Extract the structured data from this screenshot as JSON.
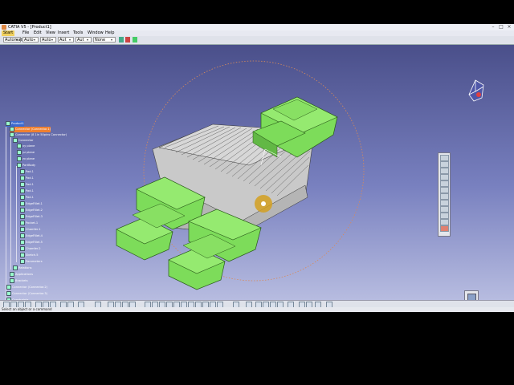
{
  "window": {
    "title": "CATIA V5 - [Product1]"
  },
  "menu": [
    "Start",
    "File",
    "Edit",
    "View",
    "Insert",
    "Tools",
    "Window",
    "Help"
  ],
  "toolbar": {
    "combos": [
      "Automatic",
      "Auto",
      "Auto",
      "Aut",
      "Aut",
      "None"
    ]
  },
  "tree": {
    "nodes": [
      "Product1",
      "Connector (Connector.1)",
      "Connector (8 1in 50pins Connector)",
      "Connector",
      "xy plane",
      "yz plane",
      "zx plane",
      "PartBody",
      "Pad.1",
      "Pad.1",
      "Pad.1",
      "Pad.1",
      "Pad.1",
      "EdgeFillet.1",
      "EdgeFillet.2",
      "EdgeFillet.3",
      "Pocket.1",
      "Chamfer.1",
      "EdgeFillet.4",
      "EdgeFillet.5",
      "Chamfer.2",
      "Sketch.5",
      "Parameters",
      "Relations",
      "Applications",
      "Brackets",
      "Connector (Connector.2)",
      "Connector (Connector.3)",
      "Constraints",
      "Applications"
    ]
  },
  "status": {
    "text": "Select an object or a command"
  },
  "colors": {
    "part_green": "#7ddc5a",
    "body_gray": "#c8c8c8",
    "sky_top": "#4a4f8a",
    "sky_bottom": "#b7bce0"
  }
}
